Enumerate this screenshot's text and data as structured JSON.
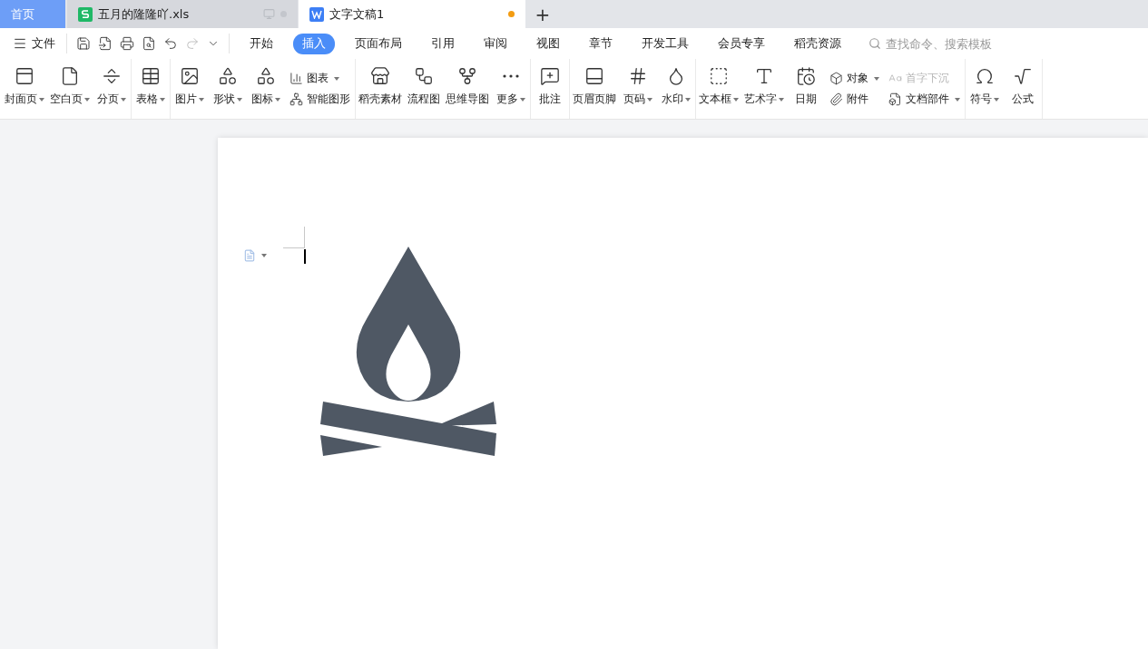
{
  "doc_tabs": [
    {
      "kind": "home",
      "label": "首页",
      "selected": false
    },
    {
      "kind": "sheet",
      "label": "五月的隆隆吖.xls",
      "selected": false,
      "modified": false
    },
    {
      "kind": "doc",
      "label": "文字文稿1",
      "selected": true,
      "modified": true
    }
  ],
  "new_tab_button": "+",
  "menu": {
    "file": "文件",
    "tabs": [
      {
        "label": "开始",
        "selected": false
      },
      {
        "label": "插入",
        "selected": true
      },
      {
        "label": "页面布局",
        "selected": false
      },
      {
        "label": "引用",
        "selected": false
      },
      {
        "label": "审阅",
        "selected": false
      },
      {
        "label": "视图",
        "selected": false
      },
      {
        "label": "章节",
        "selected": false
      },
      {
        "label": "开发工具",
        "selected": false
      },
      {
        "label": "会员专享",
        "selected": false
      },
      {
        "label": "稻壳资源",
        "selected": false
      }
    ],
    "search_placeholder": "查找命令、搜索模板"
  },
  "ribbon": [
    {
      "items": [
        {
          "kind": "big",
          "label": "封面页",
          "dropdown": true
        },
        {
          "kind": "big",
          "label": "空白页",
          "dropdown": true
        },
        {
          "kind": "big",
          "label": "分页",
          "dropdown": true
        }
      ]
    },
    {
      "items": [
        {
          "kind": "big",
          "label": "表格",
          "dropdown": true
        }
      ]
    },
    {
      "items": [
        {
          "kind": "big",
          "label": "图片",
          "dropdown": true
        },
        {
          "kind": "big",
          "label": "形状",
          "dropdown": true
        },
        {
          "kind": "big",
          "label": "图标",
          "dropdown": true
        },
        {
          "kind": "stack",
          "children": [
            {
              "label": "图表",
              "dropdown": true,
              "disabled": false
            },
            {
              "label": "智能图形",
              "dropdown": false,
              "disabled": false
            }
          ]
        }
      ]
    },
    {
      "items": [
        {
          "kind": "big",
          "label": "稻壳素材",
          "dropdown": false
        },
        {
          "kind": "big",
          "label": "流程图",
          "dropdown": false
        },
        {
          "kind": "big",
          "label": "思维导图",
          "dropdown": false
        },
        {
          "kind": "big",
          "label": "更多",
          "dropdown": true
        }
      ]
    },
    {
      "items": [
        {
          "kind": "big",
          "label": "批注",
          "dropdown": false
        }
      ]
    },
    {
      "items": [
        {
          "kind": "big",
          "label": "页眉页脚",
          "dropdown": false
        },
        {
          "kind": "big",
          "label": "页码",
          "dropdown": true
        },
        {
          "kind": "big",
          "label": "水印",
          "dropdown": true
        }
      ]
    },
    {
      "items": [
        {
          "kind": "big",
          "label": "文本框",
          "dropdown": true
        },
        {
          "kind": "big",
          "label": "艺术字",
          "dropdown": true
        },
        {
          "kind": "big",
          "label": "日期",
          "dropdown": false
        },
        {
          "kind": "stack",
          "children": [
            {
              "label": "对象",
              "dropdown": true,
              "disabled": false
            },
            {
              "label": "附件",
              "dropdown": false,
              "disabled": false
            }
          ]
        },
        {
          "kind": "stack",
          "children": [
            {
              "label": "首字下沉",
              "dropdown": false,
              "disabled": true
            },
            {
              "label": "文档部件",
              "dropdown": true,
              "disabled": false
            }
          ]
        }
      ]
    },
    {
      "items": [
        {
          "kind": "big",
          "label": "符号",
          "dropdown": true
        },
        {
          "kind": "big",
          "label": "公式",
          "dropdown": false
        }
      ]
    }
  ]
}
